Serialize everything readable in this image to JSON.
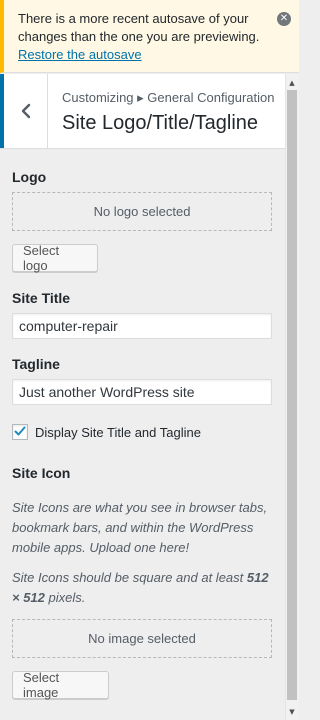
{
  "notice": {
    "text": "There is a more recent autosave of your changes than the one you are previewing.",
    "restore_link": "Restore the autosave",
    "dismiss_icon": "dismiss-icon"
  },
  "header": {
    "back_icon": "chevron-left-icon",
    "breadcrumb": "Customizing ▸ General Configuration",
    "title": "Site Logo/Title/Tagline"
  },
  "logo": {
    "label": "Logo",
    "placeholder": "No logo selected",
    "button": "Select logo"
  },
  "site_title": {
    "label": "Site Title",
    "value": "computer-repair"
  },
  "tagline": {
    "label": "Tagline",
    "value": "Just another WordPress site"
  },
  "display_title_tagline": {
    "label": "Display Site Title and Tagline",
    "checked": true
  },
  "site_icon": {
    "label": "Site Icon",
    "description1": "Site Icons are what you see in browser tabs, bookmark bars, and within the WordPress mobile apps. Upload one here!",
    "description2_prefix": "Site Icons should be square and at least ",
    "description2_size": "512 × 512",
    "description2_suffix": " pixels.",
    "placeholder": "No image selected",
    "button": "Select image"
  },
  "colors": {
    "accent": "#0073aa",
    "notice_border": "#ffb900",
    "notice_bg": "#fff8e5",
    "panel_bg": "#eeeeee"
  }
}
